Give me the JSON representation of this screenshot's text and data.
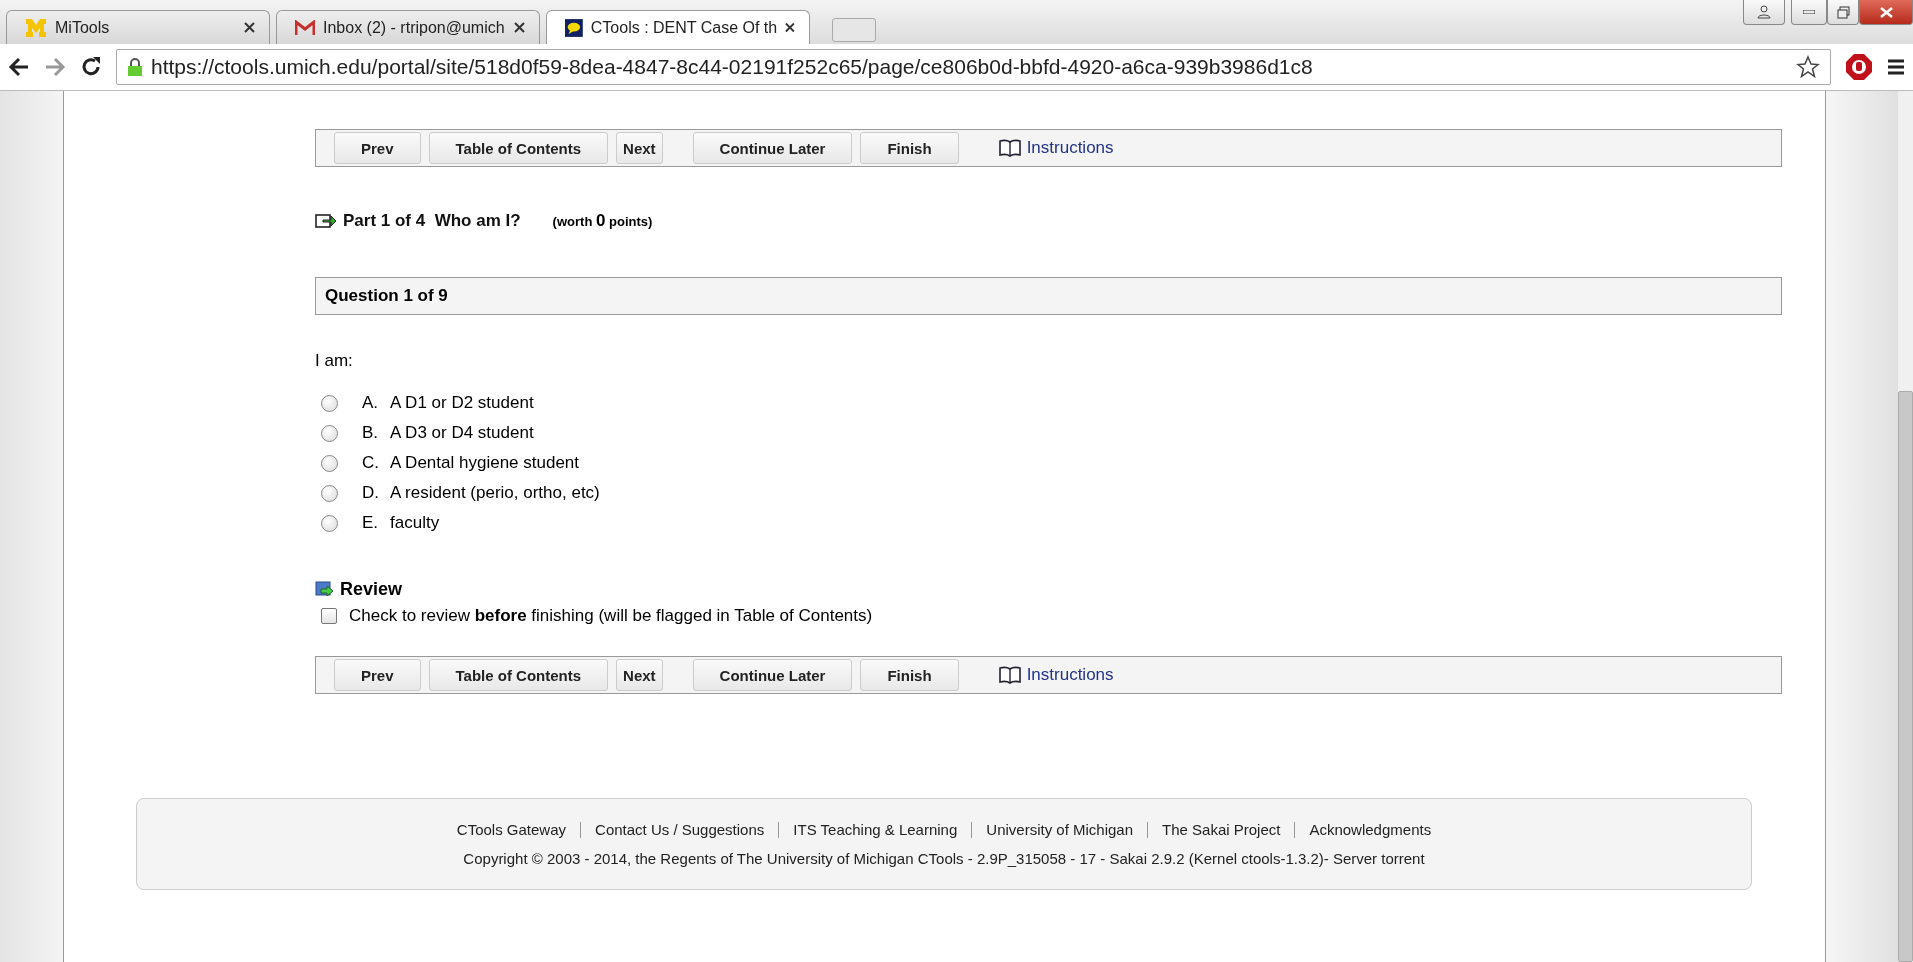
{
  "browser": {
    "tabs": [
      {
        "title": "MiTools",
        "kind": "campus",
        "selected": false
      },
      {
        "title": "Inbox (2) - rtripon@umich",
        "kind": "mail",
        "selected": false
      },
      {
        "title": "CTools : DENT Case Of th",
        "kind": "chat",
        "selected": true
      }
    ],
    "url": "https://ctools.umich.edu/portal/site/518d0f59-8dea-4847-8c44-02191f252c65/page/ce806b0d-bbfd-4920-a6ca-939b3986d1c8"
  },
  "toolbars": [
    {
      "buttons": [
        "Prev",
        "Table of Contents",
        "Next",
        "Continue Later",
        "Finish"
      ],
      "link": "Instructions"
    },
    {
      "buttons": [
        "Prev",
        "Table of Contents",
        "Next",
        "Continue Later",
        "Finish"
      ],
      "link": "Instructions"
    }
  ],
  "part": {
    "label": "Part 1 of 4",
    "title": "Who am I?",
    "worth": "(worth",
    "points": "0",
    "unit": "points)"
  },
  "question": {
    "header": "Question 1 of 9",
    "prompt": "I am:",
    "options": [
      {
        "letter": "A.",
        "text": "A D1 or D2 student",
        "selected": false
      },
      {
        "letter": "B.",
        "text": "A D3 or D4 student",
        "selected": false
      },
      {
        "letter": "C.",
        "text": "A Dental hygiene student",
        "selected": false
      },
      {
        "letter": "D.",
        "text": "A resident (perio, ortho, etc)",
        "selected": false
      },
      {
        "letter": "E.",
        "text": "faculty",
        "selected": false
      }
    ]
  },
  "review": {
    "title": "Review",
    "label": "Check to review **before** finishing (will be flagged in Table of Contents)",
    "checked": false
  },
  "footer": {
    "links": [
      "CTools Gateway",
      "Contact Us / Suggestions",
      "ITS Teaching & Learning",
      "University of Michigan",
      "The Sakai Project",
      "Acknowledgments"
    ],
    "copyright": "Copyright © 2003 - 2014, the Regents of The University of Michigan CTools - 2.9P_315058 - 17 - Sakai 2.9.2 (Kernel ctools-1.3.2)- Server torrent"
  }
}
